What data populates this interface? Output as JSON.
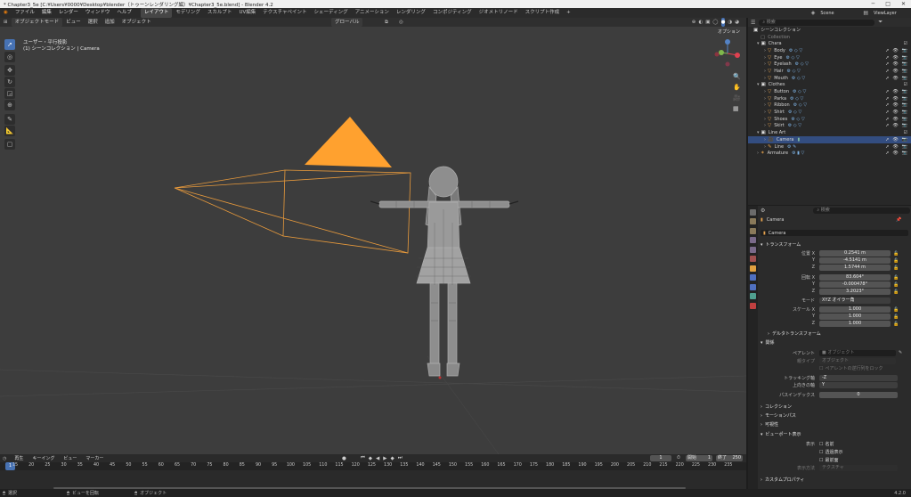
{
  "titlebar": {
    "title": "* Chapter3_5e [C:¥Users¥0000¥Desktop¥blender（トゥーンレンダリング編）¥Chapter3_5e.blend] - Blender 4.2",
    "minimize": "─",
    "maximize": "□",
    "close": "✕"
  },
  "topmenu": {
    "menus": [
      "ファイル",
      "編集",
      "レンダー",
      "ウィンドウ",
      "ヘルプ"
    ],
    "workspaces": [
      "レイアウト",
      "モデリング",
      "スカルプト",
      "UV編集",
      "テクスチャペイント",
      "シェーディング",
      "アニメーション",
      "レンダリング",
      "コンポジティング",
      "ジオメトリノード",
      "スクリプト作成"
    ],
    "add_tab": "+",
    "scene": "Scene",
    "viewlayer": "ViewLayer"
  },
  "viewport": {
    "mode": "オブジェクトモード",
    "menus": [
      "ビュー",
      "選択",
      "追加",
      "オブジェクト"
    ],
    "transform_orientation": "グローバル",
    "options": "オプション",
    "view_name": "ユーザー・平行投影",
    "collection_info": "(1) シーンコレクション | Camera",
    "gizmo_axes": [
      "X",
      "Y",
      "Z"
    ]
  },
  "outliner": {
    "search_placeholder": "検索",
    "root": "シーンコレクション",
    "rows": [
      {
        "label": "Collection",
        "depth": 1,
        "dim": true
      },
      {
        "label": "Chara",
        "depth": 1,
        "type": "collection"
      },
      {
        "label": "Body",
        "depth": 2
      },
      {
        "label": "Eye",
        "depth": 2
      },
      {
        "label": "Eyelash",
        "depth": 2
      },
      {
        "label": "Hair",
        "depth": 2
      },
      {
        "label": "Mouth",
        "depth": 2
      },
      {
        "label": "Clothes",
        "depth": 1,
        "type": "collection"
      },
      {
        "label": "Button",
        "depth": 2
      },
      {
        "label": "Parka",
        "depth": 2
      },
      {
        "label": "Ribbon",
        "depth": 2
      },
      {
        "label": "Shirt",
        "depth": 2
      },
      {
        "label": "Shoes",
        "depth": 2
      },
      {
        "label": "Skirt",
        "depth": 2
      },
      {
        "label": "Line Art",
        "depth": 1,
        "type": "collection"
      },
      {
        "label": "Camera",
        "depth": 2,
        "selected": true
      },
      {
        "label": "Line",
        "depth": 2
      },
      {
        "label": "Armature",
        "depth": 1
      }
    ]
  },
  "properties": {
    "search_placeholder": "検索",
    "object_name_header": "Camera",
    "object_name_field": "Camera",
    "transform": {
      "title": "トランスフォーム",
      "location_label": "位置 X",
      "location": [
        "0.2541 m",
        "-4.5141 m",
        "1.5744 m"
      ],
      "rotation_label": "回転 X",
      "rotation": [
        "83.604°",
        "-0.000478°",
        "3.2023°"
      ],
      "mode_label": "モード",
      "mode_value": "XYZ オイラー角",
      "scale_label": "スケール X",
      "scale": [
        "1.000",
        "1.000",
        "1.000"
      ],
      "axis_labels": [
        "Y",
        "Z"
      ]
    },
    "delta_transform": "デルタトランスフォーム",
    "relations": {
      "title": "関係",
      "parent_label": "ペアレント",
      "parent_placeholder": "オブジェクト",
      "parent_type_label": "親タイプ",
      "parent_type_value": "オブジェクト",
      "lock_label": "ペアレントの逆行列をロック",
      "tracking_axis_label": "トラッキング軸",
      "tracking_axis_value": "-Z",
      "up_axis_label": "上向きの軸",
      "up_axis_value": "Y",
      "pass_index_label": "パスインデックス",
      "pass_index_value": "0"
    },
    "sections": [
      "コレクション",
      "モーションパス",
      "可視性"
    ],
    "viewport_display": {
      "title": "ビューポート表示",
      "show_label": "表示",
      "options": [
        "名前",
        "透過表示",
        "最前面"
      ],
      "display_as_label": "表示方法",
      "display_as_value": "テクスチャ"
    },
    "custom_props": "カスタムプロパティ"
  },
  "timeline": {
    "menus": [
      "再生",
      "キーイング",
      "ビュー",
      "マーカー"
    ],
    "current_frame": "1",
    "start_label": "開始",
    "start": "1",
    "end_label": "終了",
    "end": "250",
    "ticks": [
      "1",
      "15",
      "20",
      "25",
      "30",
      "35",
      "40",
      "45",
      "50",
      "55",
      "60",
      "65",
      "70",
      "75",
      "80",
      "85",
      "90",
      "95",
      "100",
      "105",
      "110",
      "115",
      "120",
      "125",
      "130",
      "135",
      "140",
      "145",
      "150",
      "155",
      "160",
      "165",
      "170",
      "175",
      "180",
      "185",
      "190",
      "195",
      "200",
      "205",
      "210",
      "215",
      "220",
      "225",
      "230",
      "235"
    ]
  },
  "statusbar": {
    "select": "選択",
    "rotate": "ビューを回転",
    "object": "オブジェクト",
    "version": "4.2.0"
  },
  "colors": {
    "accent": "#4772b3",
    "camera_orange": "#ffa12f",
    "selection_row": "#334d80"
  }
}
